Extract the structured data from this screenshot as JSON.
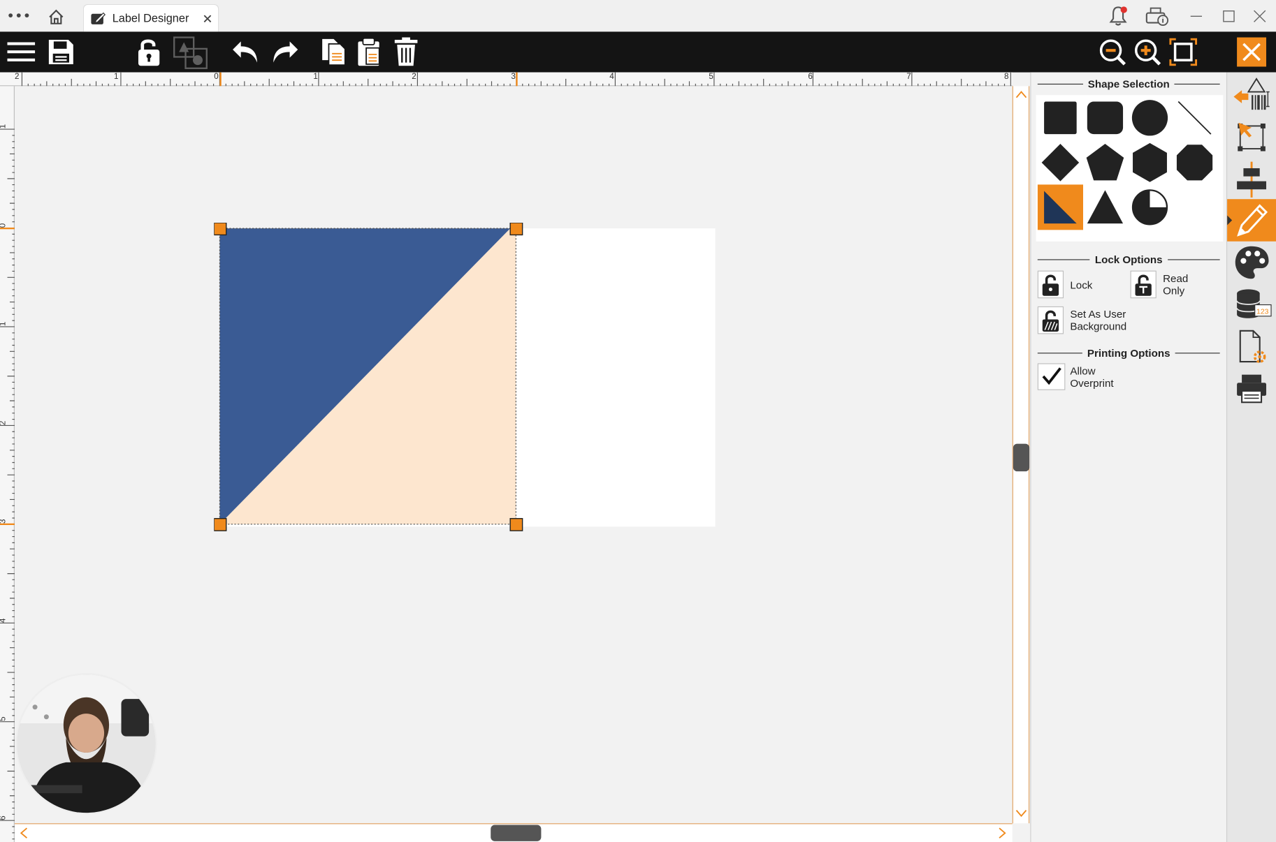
{
  "window": {
    "tab_title": "Label Designer",
    "icons": [
      "more-icon",
      "home-icon",
      "edit-icon",
      "close-tab-icon",
      "notification-bell-icon",
      "printer-info-icon",
      "minimize-icon",
      "maximize-icon",
      "close-window-icon"
    ]
  },
  "toolbar": {
    "left_icons": [
      "menu-icon",
      "save-icon",
      "unlock-icon",
      "group-icon",
      "undo-icon",
      "redo-icon",
      "copy-icon",
      "paste-icon",
      "delete-icon"
    ],
    "right_icons": [
      "zoom-out-icon",
      "zoom-in-icon",
      "fit-to-page-icon",
      "close-designer-icon"
    ]
  },
  "ruler": {
    "horizontal": [
      "2",
      "1",
      "0",
      "1",
      "2",
      "3",
      "4",
      "5",
      "6",
      "7",
      "8"
    ],
    "vertical": [
      "1",
      "0",
      "1",
      "2",
      "3",
      "4",
      "5",
      "6"
    ]
  },
  "canvas": {
    "shape": "right-triangle",
    "fill_color": "#3a5b94",
    "background_color": "#fde6cf",
    "label_color": "#ffffff"
  },
  "panel": {
    "shape_selection": {
      "title": "Shape Selection",
      "shapes": [
        "rectangle",
        "rounded-rectangle",
        "circle",
        "line",
        "diamond",
        "pentagon",
        "hexagon",
        "octagon",
        "right-triangle",
        "triangle",
        "pie"
      ],
      "selected": "right-triangle"
    },
    "lock_options": {
      "title": "Lock Options",
      "lock_label": "Lock",
      "read_only_label_1": "Read",
      "read_only_label_2": "Only",
      "user_background_label_1": "Set As User",
      "user_background_label_2": "Background"
    },
    "printing_options": {
      "title": "Printing Options",
      "allow_overprint_label_1": "Allow",
      "allow_overprint_label_2": "Overprint",
      "allow_overprint_checked": true
    }
  },
  "rail": {
    "icons": [
      "barcode-hazard-icon",
      "select-object-icon",
      "align-icon",
      "pencil-icon",
      "palette-icon",
      "database-icon",
      "page-settings-icon",
      "print-icon"
    ],
    "active": "pencil-icon"
  },
  "colors": {
    "accent": "#f08a1c",
    "toolbar": "#141414",
    "selected_shape": "#f08a1c"
  }
}
